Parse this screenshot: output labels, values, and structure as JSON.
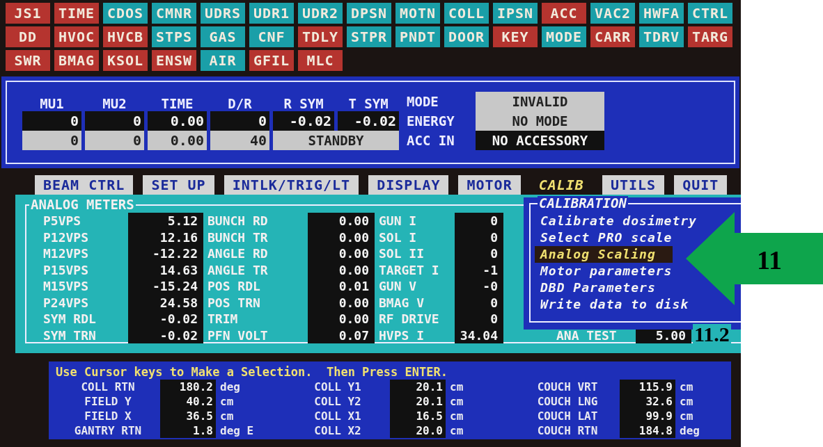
{
  "status_tiles": [
    [
      {
        "label": "JS1",
        "color": "#b5342f"
      },
      {
        "label": "TIME",
        "color": "#b5342f"
      },
      {
        "label": "CDOS",
        "color": "#1a9fa8"
      },
      {
        "label": "CMNR",
        "color": "#1a9fa8"
      },
      {
        "label": "UDRS",
        "color": "#1a9fa8"
      },
      {
        "label": "UDR1",
        "color": "#1a9fa8"
      },
      {
        "label": "UDR2",
        "color": "#1a9fa8"
      },
      {
        "label": "DPSN",
        "color": "#1a9fa8"
      },
      {
        "label": "MOTN",
        "color": "#1a9fa8"
      },
      {
        "label": "COLL",
        "color": "#1a9fa8"
      },
      {
        "label": "IPSN",
        "color": "#1a9fa8"
      },
      {
        "label": "ACC",
        "color": "#b5342f"
      },
      {
        "label": "VAC2",
        "color": "#1a9fa8"
      },
      {
        "label": "HWFA",
        "color": "#1a9fa8"
      },
      {
        "label": "CTRL",
        "color": "#1a9fa8"
      }
    ],
    [
      {
        "label": "DD",
        "color": "#b5342f"
      },
      {
        "label": "HVOC",
        "color": "#b5342f"
      },
      {
        "label": "HVCB",
        "color": "#b5342f"
      },
      {
        "label": "STPS",
        "color": "#1a9fa8"
      },
      {
        "label": "GAS",
        "color": "#1a9fa8"
      },
      {
        "label": "CNF",
        "color": "#1a9fa8"
      },
      {
        "label": "TDLY",
        "color": "#b5342f"
      },
      {
        "label": "STPR",
        "color": "#1a9fa8"
      },
      {
        "label": "PNDT",
        "color": "#1a9fa8"
      },
      {
        "label": "DOOR",
        "color": "#1a9fa8"
      },
      {
        "label": "KEY",
        "color": "#b5342f"
      },
      {
        "label": "MODE",
        "color": "#1a9fa8"
      },
      {
        "label": "CARR",
        "color": "#b5342f"
      },
      {
        "label": "TDRV",
        "color": "#1a9fa8"
      },
      {
        "label": "TARG",
        "color": "#b5342f"
      }
    ],
    [
      {
        "label": "SWR",
        "color": "#b5342f"
      },
      {
        "label": "BMAG",
        "color": "#b5342f"
      },
      {
        "label": "KSOL",
        "color": "#b5342f"
      },
      {
        "label": "ENSW",
        "color": "#b5342f"
      },
      {
        "label": "AIR",
        "color": "#1a9fa8"
      },
      {
        "label": "GFIL",
        "color": "#b5342f"
      },
      {
        "label": "MLC",
        "color": "#b5342f"
      }
    ]
  ],
  "dose_panel": {
    "columns": [
      {
        "header": "MU1",
        "actual": "0",
        "preset": "0"
      },
      {
        "header": "MU2",
        "actual": "0",
        "preset": "0"
      },
      {
        "header": "TIME",
        "actual": "0.00",
        "preset": "0.00"
      },
      {
        "header": "D/R",
        "actual": "0",
        "preset": "40"
      },
      {
        "header": "R SYM",
        "actual": "-0.02"
      },
      {
        "header": "T SYM",
        "actual": "-0.02"
      }
    ],
    "state": "STANDBY",
    "fields": [
      {
        "label": "MODE",
        "value": "INVALID",
        "kind": "light"
      },
      {
        "label": "ENERGY",
        "value": "NO MODE",
        "kind": "light"
      },
      {
        "label": "ACC IN",
        "value": "NO ACCESSORY",
        "kind": "dark"
      }
    ]
  },
  "tabs": [
    {
      "label": "BEAM CTRL",
      "selected": false
    },
    {
      "label": "SET UP",
      "selected": false
    },
    {
      "label": "INTLK/TRIG/LT",
      "selected": false
    },
    {
      "label": "DISPLAY",
      "selected": false
    },
    {
      "label": "MOTOR",
      "selected": false
    },
    {
      "label": "CALIB",
      "selected": true
    },
    {
      "label": "UTILS",
      "selected": false
    },
    {
      "label": "QUIT",
      "selected": false
    }
  ],
  "analog_meters": {
    "title": "ANALOG METERS",
    "columns": [
      [
        {
          "label": "P5VPS",
          "value": "5.12"
        },
        {
          "label": "P12VPS",
          "value": "12.16"
        },
        {
          "label": "M12VPS",
          "value": "-12.22"
        },
        {
          "label": "P15VPS",
          "value": "14.63"
        },
        {
          "label": "M15VPS",
          "value": "-15.24"
        },
        {
          "label": "P24VPS",
          "value": "24.58"
        },
        {
          "label": "SYM RDL",
          "value": "-0.02"
        },
        {
          "label": "SYM TRN",
          "value": "-0.02"
        }
      ],
      [
        {
          "label": "BUNCH RD",
          "value": "0.00"
        },
        {
          "label": "BUNCH TR",
          "value": "0.00"
        },
        {
          "label": "ANGLE RD",
          "value": "0.00"
        },
        {
          "label": "ANGLE TR",
          "value": "0.00"
        },
        {
          "label": "POS RDL",
          "value": "0.01"
        },
        {
          "label": "POS TRN",
          "value": "0.00"
        },
        {
          "label": "TRIM",
          "value": "0.00"
        },
        {
          "label": "PFN VOLT",
          "value": "0.07"
        }
      ],
      [
        {
          "label": "GUN I",
          "value": "0"
        },
        {
          "label": "SOL I",
          "value": "0"
        },
        {
          "label": "SOL II",
          "value": "0"
        },
        {
          "label": "TARGET I",
          "value": "-1"
        },
        {
          "label": "GUN V",
          "value": "-0"
        },
        {
          "label": "BMAG V",
          "value": "0"
        },
        {
          "label": "RF DRIVE",
          "value": "0"
        },
        {
          "label": "HVPS I",
          "value": "34.04"
        }
      ]
    ],
    "extra": {
      "label": "ANA TEST",
      "value": "5.00"
    }
  },
  "calibration_menu": {
    "title": "CALIBRATION",
    "items": [
      {
        "label": "Calibrate dosimetry",
        "selected": false
      },
      {
        "label": "Select PRO scale",
        "selected": false
      },
      {
        "label": "Analog Scaling",
        "selected": true
      },
      {
        "label": "Motor parameters",
        "selected": false
      },
      {
        "label": "DBD Parameters",
        "selected": false
      },
      {
        "label": "Write data to disk",
        "selected": false
      }
    ]
  },
  "prompt": "Use Cursor keys to Make a Selection.  Then Press ENTER.",
  "positions": [
    [
      {
        "label": "COLL RTN",
        "value": "180.2",
        "unit": "deg"
      },
      {
        "label": "FIELD Y",
        "value": "40.2",
        "unit": "cm"
      },
      {
        "label": "FIELD X",
        "value": "36.5",
        "unit": "cm"
      },
      {
        "label": "GANTRY RTN",
        "value": "1.8",
        "unit": "deg E"
      }
    ],
    [
      {
        "label": "COLL Y1",
        "value": "20.1",
        "unit": "cm"
      },
      {
        "label": "COLL Y2",
        "value": "20.1",
        "unit": "cm"
      },
      {
        "label": "COLL X1",
        "value": "16.5",
        "unit": "cm"
      },
      {
        "label": "COLL X2",
        "value": "20.0",
        "unit": "cm"
      }
    ],
    [
      {
        "label": "COUCH VRT",
        "value": "115.9",
        "unit": "cm"
      },
      {
        "label": "COUCH LNG",
        "value": "32.6",
        "unit": "cm"
      },
      {
        "label": "COUCH LAT",
        "value": "99.9",
        "unit": "cm"
      },
      {
        "label": "COUCH RTN",
        "value": "184.8",
        "unit": "deg"
      }
    ]
  ],
  "annotations": [
    {
      "text": "11"
    },
    {
      "text": "11.2"
    }
  ]
}
